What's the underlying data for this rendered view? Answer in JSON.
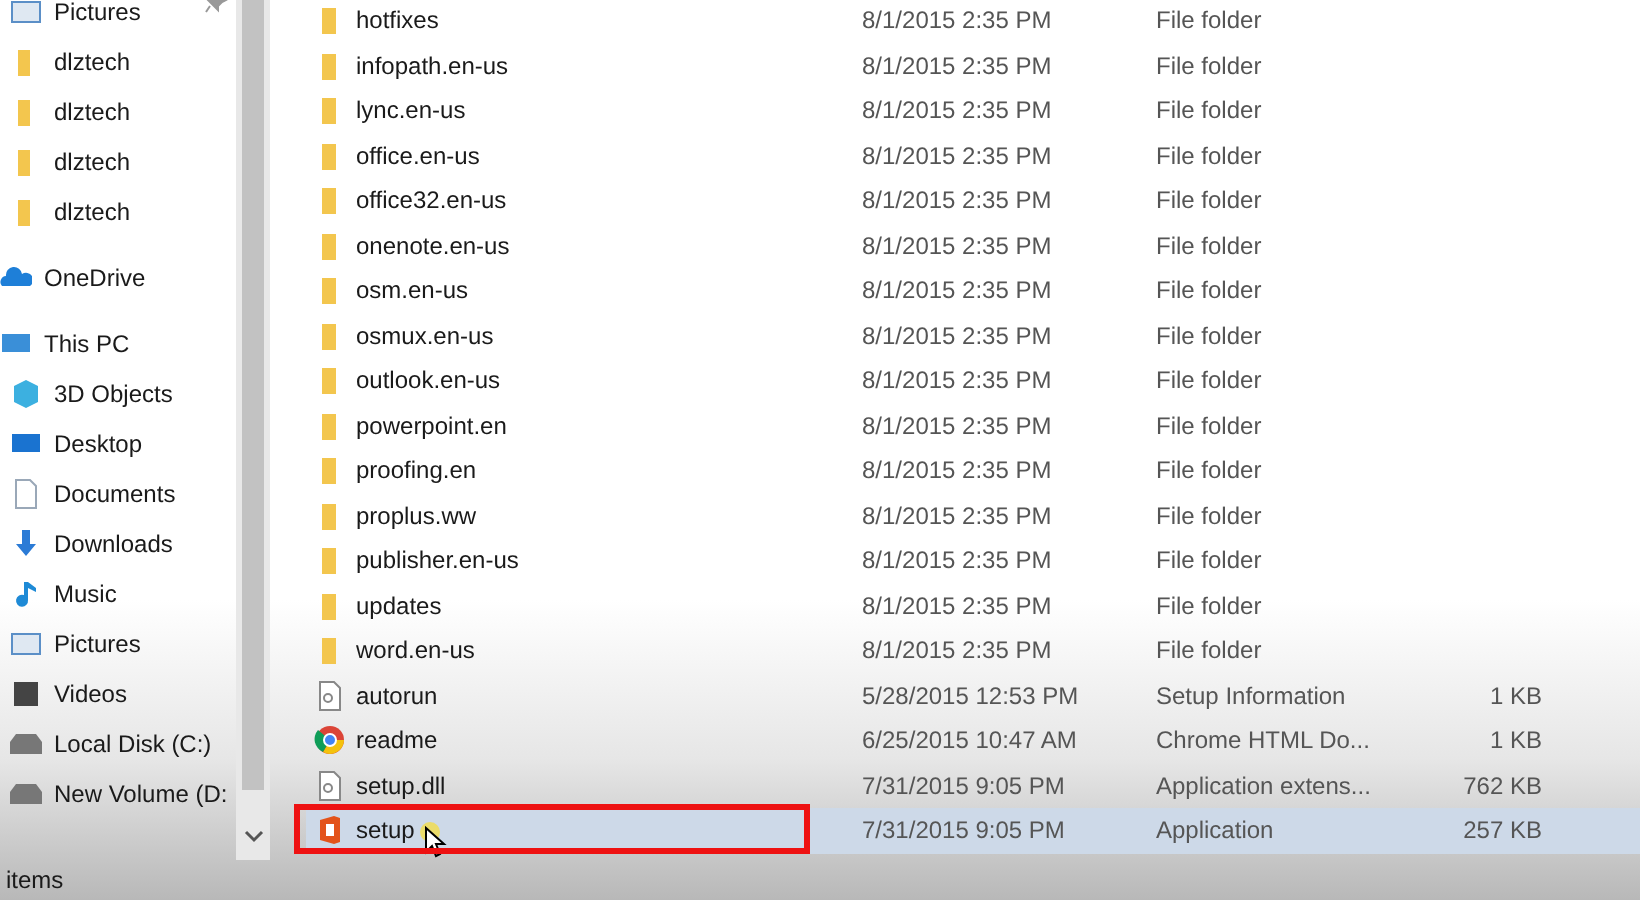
{
  "sidebar": {
    "items": [
      {
        "label": "Pictures",
        "kind": "pictures",
        "pinned": true,
        "top": false
      },
      {
        "label": "dlztech",
        "kind": "folder",
        "pinned": false,
        "top": false
      },
      {
        "label": "dlztech",
        "kind": "folder",
        "pinned": false,
        "top": false
      },
      {
        "label": "dlztech",
        "kind": "folder",
        "pinned": false,
        "top": false
      },
      {
        "label": "dlztech",
        "kind": "folder",
        "pinned": false,
        "top": false
      },
      {
        "label": "OneDrive",
        "kind": "cloud",
        "pinned": false,
        "top": true
      },
      {
        "label": "This PC",
        "kind": "pc",
        "pinned": false,
        "top": true,
        "children": [
          {
            "label": "3D Objects",
            "kind": "cube",
            "pinned": false,
            "top": false
          },
          {
            "label": "Desktop",
            "kind": "desktop",
            "pinned": false,
            "top": false
          },
          {
            "label": "Documents",
            "kind": "document",
            "pinned": false,
            "top": false
          },
          {
            "label": "Downloads",
            "kind": "download",
            "pinned": false,
            "top": false
          },
          {
            "label": "Music",
            "kind": "music",
            "pinned": false,
            "top": false
          },
          {
            "label": "Pictures",
            "kind": "pictures",
            "pinned": false,
            "top": false
          },
          {
            "label": "Videos",
            "kind": "video",
            "pinned": false,
            "top": false
          },
          {
            "label": "Local Disk (C:)",
            "kind": "drive",
            "pinned": false,
            "top": false
          },
          {
            "label": "New Volume (D:",
            "kind": "drive",
            "pinned": false,
            "top": false
          }
        ]
      }
    ]
  },
  "files": {
    "rows": [
      {
        "name": "hotfixes",
        "date": "8/1/2015 2:35 PM",
        "type": "File folder",
        "kind": "folder",
        "selected": false
      },
      {
        "name": "infopath.en-us",
        "date": "8/1/2015 2:35 PM",
        "type": "File folder",
        "kind": "folder",
        "selected": false
      },
      {
        "name": "lync.en-us",
        "date": "8/1/2015 2:35 PM",
        "type": "File folder",
        "kind": "folder",
        "selected": false
      },
      {
        "name": "office.en-us",
        "date": "8/1/2015 2:35 PM",
        "type": "File folder",
        "kind": "folder",
        "selected": false
      },
      {
        "name": "office32.en-us",
        "date": "8/1/2015 2:35 PM",
        "type": "File folder",
        "kind": "folder",
        "selected": false
      },
      {
        "name": "onenote.en-us",
        "date": "8/1/2015 2:35 PM",
        "type": "File folder",
        "kind": "folder",
        "selected": false
      },
      {
        "name": "osm.en-us",
        "date": "8/1/2015 2:35 PM",
        "type": "File folder",
        "kind": "folder",
        "selected": false
      },
      {
        "name": "osmux.en-us",
        "date": "8/1/2015 2:35 PM",
        "type": "File folder",
        "kind": "folder",
        "selected": false
      },
      {
        "name": "outlook.en-us",
        "date": "8/1/2015 2:35 PM",
        "type": "File folder",
        "kind": "folder",
        "selected": false
      },
      {
        "name": "powerpoint.en",
        "date": "8/1/2015 2:35 PM",
        "type": "File folder",
        "kind": "folder",
        "selected": false
      },
      {
        "name": "proofing.en",
        "date": "8/1/2015 2:35 PM",
        "type": "File folder",
        "kind": "folder",
        "selected": false
      },
      {
        "name": "proplus.ww",
        "date": "8/1/2015 2:35 PM",
        "type": "File folder",
        "kind": "folder",
        "selected": false
      },
      {
        "name": "publisher.en-us",
        "date": "8/1/2015 2:35 PM",
        "type": "File folder",
        "kind": "folder",
        "selected": false
      },
      {
        "name": "updates",
        "date": "8/1/2015 2:35 PM",
        "type": "File folder",
        "kind": "folder",
        "selected": false
      },
      {
        "name": "word.en-us",
        "date": "8/1/2015 2:35 PM",
        "type": "File folder",
        "kind": "folder",
        "selected": false
      },
      {
        "name": "autorun",
        "date": "5/28/2015 12:53 PM",
        "type": "Setup Information",
        "size": "1 KB",
        "kind": "setup-info",
        "selected": false
      },
      {
        "name": "readme",
        "date": "6/25/2015 10:47 AM",
        "type": "Chrome HTML Do...",
        "size": "1 KB",
        "kind": "web",
        "selected": false
      },
      {
        "name": "setup.dll",
        "date": "7/31/2015 9:05 PM",
        "type": "Application extens...",
        "size": "762 KB",
        "kind": "dll",
        "selected": false
      },
      {
        "name": "setup",
        "date": "7/31/2015 9:05 PM",
        "type": "Application",
        "size": "257 KB",
        "kind": "office",
        "selected": true
      }
    ]
  },
  "status_bar": {
    "text": "items"
  }
}
